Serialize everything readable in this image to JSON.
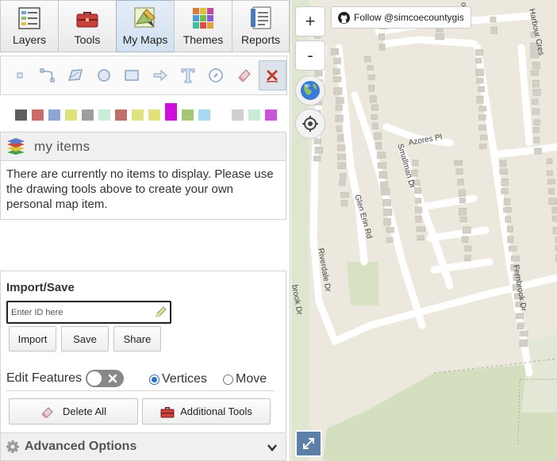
{
  "tabs": [
    {
      "label": "Layers",
      "icon": "layers-icon",
      "active": false
    },
    {
      "label": "Tools",
      "icon": "toolbox-icon",
      "active": false
    },
    {
      "label": "My Maps",
      "icon": "draw-icon",
      "active": true
    },
    {
      "label": "Themes",
      "icon": "themes-icon",
      "active": false
    },
    {
      "label": "Reports",
      "icon": "reports-icon",
      "active": false
    }
  ],
  "draw_tools": [
    "point-tool-icon",
    "line-tool-icon",
    "polygon-tool-icon",
    "circle-tool-icon",
    "rectangle-tool-icon",
    "arrow-tool-icon",
    "text-tool-icon",
    "bearing-tool-icon",
    "eraser-tool-icon",
    "cancel-tool-icon"
  ],
  "colors": [
    "#5e5e5e",
    "#cc6c68",
    "#8ca6d6",
    "#dce37c",
    "#9e9e9e",
    "#c9ecd6",
    "#bf6f69",
    "#dce37c",
    "#e6e07c",
    "#cc10d9",
    "#a4c878",
    "#a6d8f2",
    "#cfcfcf",
    "#c9ecd6",
    "#c956d9"
  ],
  "selected_color_index": 9,
  "my_items": {
    "title": "my items",
    "empty_message": "There are currently no items to display. Please use the drawing tools above to create your own personal map item."
  },
  "import_save": {
    "title": "Import/Save",
    "placeholder": "Enter ID here",
    "value": "",
    "import_label": "Import",
    "save_label": "Save",
    "share_label": "Share"
  },
  "edit": {
    "label": "Edit Features",
    "toggle_on": false,
    "vertices_label": "Vertices",
    "move_label": "Move",
    "selected": "Vertices"
  },
  "actions": {
    "delete_all_label": "Delete All",
    "additional_tools_label": "Additional Tools"
  },
  "advanced_label": "Advanced Options",
  "map": {
    "zoom_in": "+",
    "zoom_out": "-",
    "follow_label": "Follow @simcoecountygis",
    "streets": [
      "Fatima",
      "Harbour Cres",
      "Azores Pl",
      "Smallman Dr",
      "Glen Erin Rd",
      "Riverdale Dr",
      "Fernbrook Dr",
      "brook Dr",
      "ok Dr"
    ]
  }
}
